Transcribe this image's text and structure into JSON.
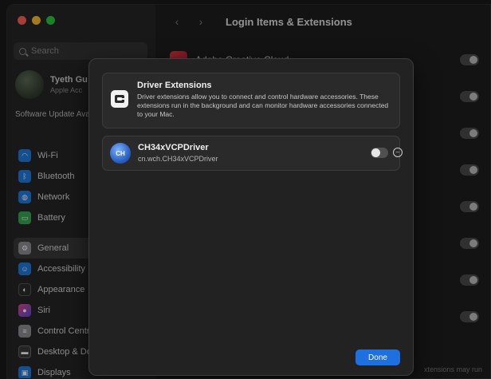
{
  "window": {
    "title": "Login Items & Extensions"
  },
  "sidebar": {
    "search_placeholder": "Search",
    "account": {
      "name": "Tyeth Gu",
      "subtitle": "Apple Acc"
    },
    "software_update": "Software Update Available",
    "items": [
      {
        "label": "Wi-Fi",
        "icon": "wifi-icon",
        "color": "#1f7ae0"
      },
      {
        "label": "Bluetooth",
        "icon": "bluetooth-icon",
        "color": "#1f7ae0"
      },
      {
        "label": "Network",
        "icon": "globe-icon",
        "color": "#1f7ae0"
      },
      {
        "label": "Battery",
        "icon": "battery-icon",
        "color": "#36a852"
      },
      {
        "label": "General",
        "icon": "gear-icon",
        "color": "#8e8e93"
      },
      {
        "label": "Accessibility",
        "icon": "accessibility-icon",
        "color": "#1f7ae0"
      },
      {
        "label": "Appearance",
        "icon": "appearance-icon",
        "color": "#2c2c2c"
      },
      {
        "label": "Siri",
        "icon": "siri-icon",
        "color": "#a34cd8"
      },
      {
        "label": "Control Centre",
        "icon": "control-centre-icon",
        "color": "#8e8e93"
      },
      {
        "label": "Desktop & Dock",
        "icon": "dock-icon",
        "color": "#3a3a3a"
      },
      {
        "label": "Displays",
        "icon": "display-icon",
        "color": "#1f7ae0"
      }
    ]
  },
  "main": {
    "first_item": "Adobe Creative Cloud",
    "footer_fragment": "xtensions may run"
  },
  "sheet": {
    "info_title": "Driver Extensions",
    "info_text": "Driver extensions allow you to connect and control hardware accessories. These extensions run in the background and can monitor hardware accessories connected to your Mac.",
    "driver": {
      "icon_text": "CH",
      "name": "CH34xVCPDriver",
      "bundle_id": "cn.wch.CH34xVCPDriver",
      "enabled": false
    },
    "done_label": "Done"
  },
  "colors": {
    "accent": "#1e6fe0"
  }
}
